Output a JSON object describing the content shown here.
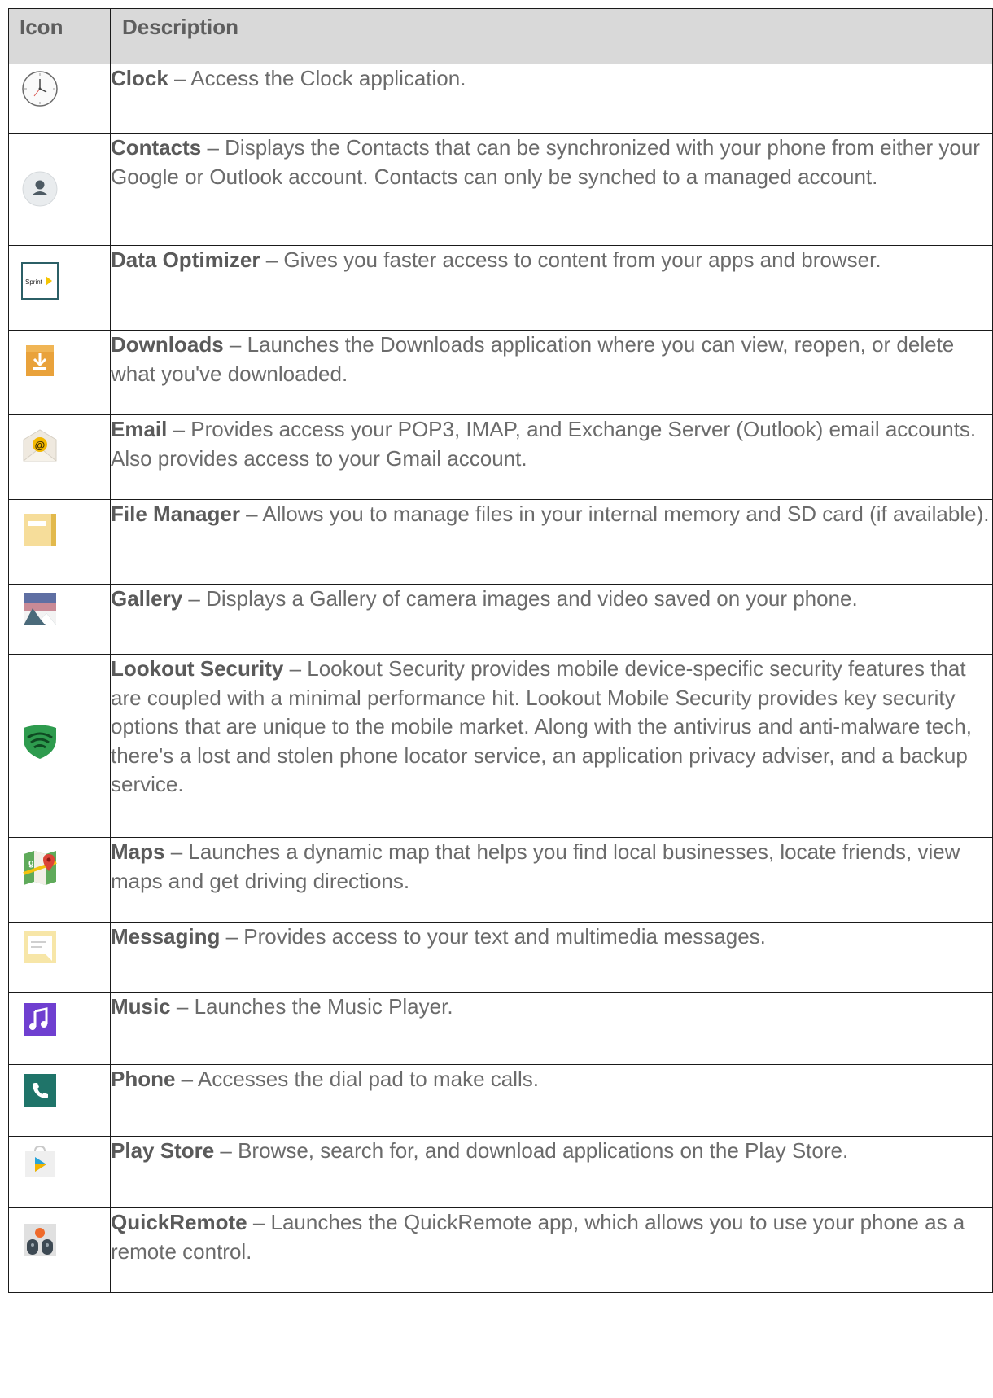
{
  "header": {
    "col_icon": "Icon",
    "col_description": "Description"
  },
  "rows": [
    {
      "name": "Clock",
      "desc": " – Access the Clock application.",
      "icon": "clock-icon",
      "icon_text": ""
    },
    {
      "name": "Contacts",
      "desc": " – Displays the Contacts that can be synchronized with your phone from either your Google or Outlook account. Contacts can only be synched to a managed account.",
      "icon": "contacts-icon",
      "icon_text": ""
    },
    {
      "name": "Data Optimizer",
      "desc": " – Gives you faster access to content from your apps and browser.",
      "icon": "sprint-data-optimizer-icon",
      "icon_text": "Sprint"
    },
    {
      "name": "Downloads",
      "desc": " – Launches the Downloads application where you can view, reopen, or delete what you've downloaded.",
      "icon": "downloads-icon",
      "icon_text": ""
    },
    {
      "name": "Email",
      "desc": " – Provides access your POP3, IMAP, and Exchange Server (Outlook) email accounts. Also provides access to your Gmail account.",
      "icon": "email-icon",
      "icon_text": "@"
    },
    {
      "name": "File Manager",
      "desc": " – Allows you to manage files in your internal memory and SD card (if available).",
      "icon": "folder-icon",
      "icon_text": ""
    },
    {
      "name": "Gallery",
      "desc": " – Displays a Gallery of camera images and video saved on your phone.",
      "icon": "gallery-icon",
      "icon_text": ""
    },
    {
      "name": "Lookout Security",
      "desc": " – Lookout Security provides mobile device-specific security features that are coupled with a minimal performance hit. Lookout Mobile Security provides key security options that are unique to the mobile market. Along with the antivirus and anti-malware tech, there's a lost and stolen phone locator service, an application privacy adviser, and a backup service.",
      "icon": "lookout-shield-icon",
      "icon_text": ""
    },
    {
      "name": "Maps",
      "desc": " – Launches a dynamic map that helps you find local businesses, locate friends, view maps and get driving directions.",
      "icon": "maps-icon",
      "icon_text": ""
    },
    {
      "name": "Messaging",
      "desc": " – Provides access to your text and multimedia messages.",
      "icon": "messaging-icon",
      "icon_text": ""
    },
    {
      "name": "Music",
      "desc": " – Launches the Music Player.",
      "icon": "music-icon",
      "icon_text": ""
    },
    {
      "name": "Phone",
      "desc": " – Accesses the dial pad to make calls.",
      "icon": "phone-icon",
      "icon_text": ""
    },
    {
      "name": "Play Store",
      "desc": " – Browse, search for, and download applications on the Play Store.",
      "icon": "play-store-icon",
      "icon_text": ""
    },
    {
      "name": "QuickRemote",
      "desc": " – Launches the QuickRemote app, which allows you to use your phone as a remote control.",
      "icon": "quickremote-icon",
      "icon_text": ""
    }
  ]
}
